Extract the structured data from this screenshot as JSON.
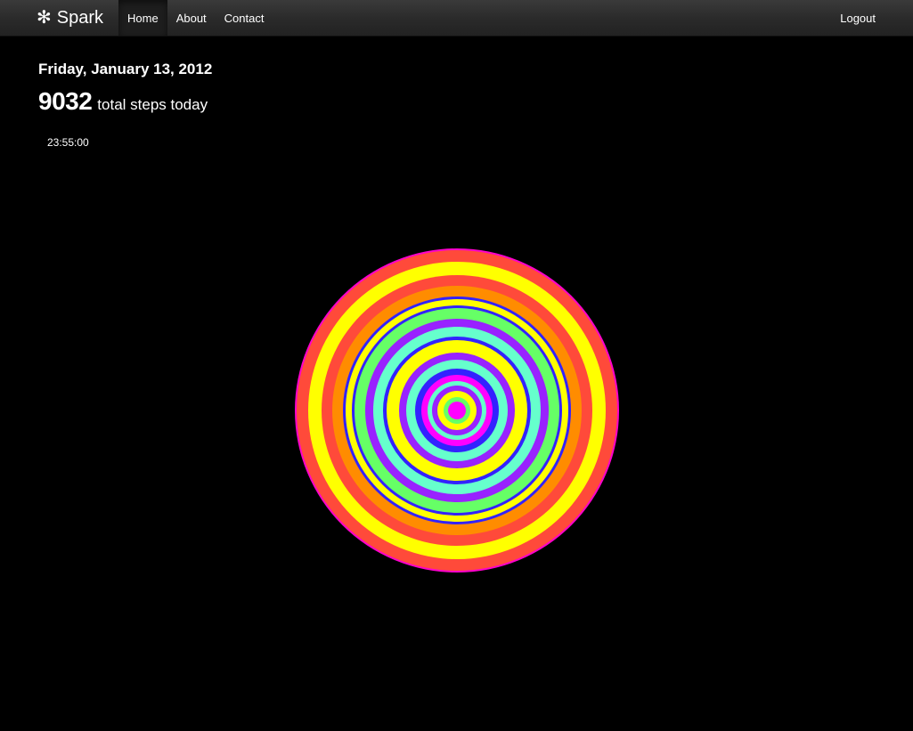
{
  "navbar": {
    "brand": {
      "icon": "asterisk-spark-icon",
      "glyph": "✻",
      "label": "Spark"
    },
    "items": [
      {
        "label": "Home",
        "active": true
      },
      {
        "label": "About",
        "active": false
      },
      {
        "label": "Contact",
        "active": false
      }
    ],
    "logout_label": "Logout"
  },
  "main": {
    "date": "Friday, January 13, 2012",
    "total_steps": "9032",
    "steps_label": "total steps today",
    "time": "23:55:00"
  },
  "visualization": {
    "center_dot_color": "#ff00ff",
    "ring_colors_outer_to_inner": [
      "#ff00cc",
      "#ff4a3a",
      "#ffff00",
      "#ff4a3a",
      "#ff8c00",
      "#3322ff",
      "#ffff00",
      "#3322ff",
      "#66ff66",
      "#9922ff",
      "#66ffcc",
      "#3322ff",
      "#ffff00",
      "#9922ff",
      "#66ffcc",
      "#3322ff",
      "#ff00ff",
      "#66ffcc",
      "#9922ff",
      "#ffff00",
      "#66ff66",
      "#ff00ff"
    ]
  }
}
